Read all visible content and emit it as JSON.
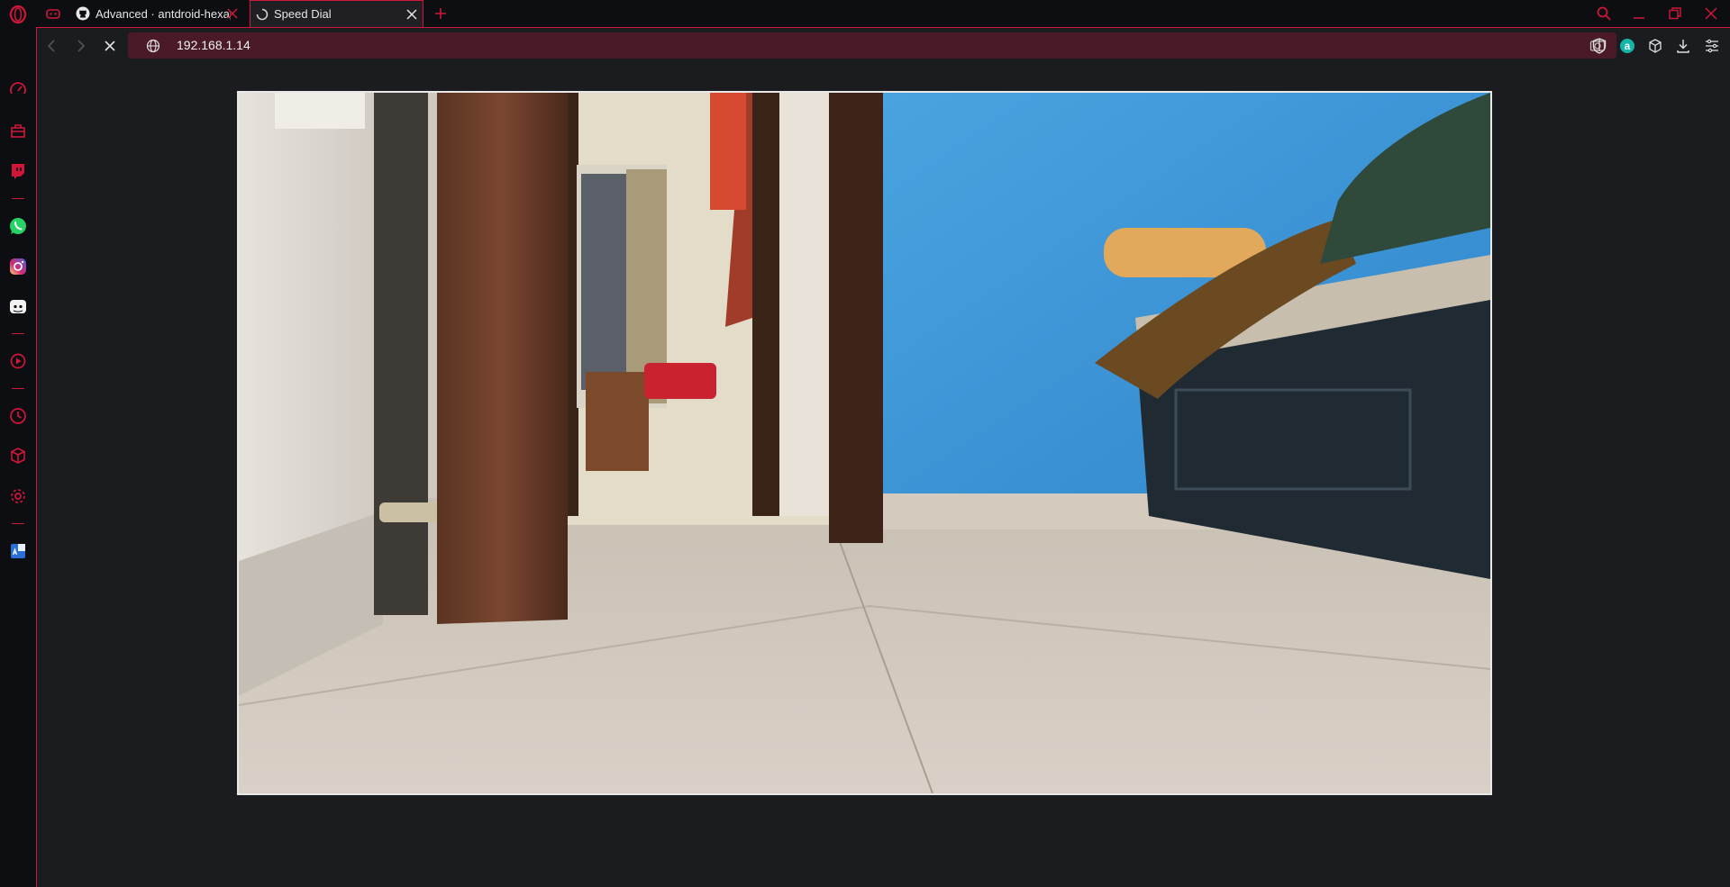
{
  "tabs": [
    {
      "title": "Advanced · antdroid-hexapod",
      "favicon": "github-icon"
    },
    {
      "title": "Speed Dial",
      "favicon": "loading-spinner-icon",
      "active": true
    }
  ],
  "address_bar": {
    "url": "192.168.1.14"
  },
  "colors": {
    "accent": "#d0173a",
    "frame": "#0d0e12",
    "page_bg": "#1b1c20",
    "urlbar": "#4a1a28"
  },
  "sidebar": {
    "items": [
      "speed-dial-icon",
      "shopping-bag-icon",
      "twitch-icon",
      "whatsapp-icon",
      "instagram-icon",
      "discord-icon",
      "player-icon",
      "history-icon",
      "extensions-icon",
      "settings-icon",
      "translator-icon"
    ]
  },
  "content": {
    "type": "camera-stream-image"
  }
}
